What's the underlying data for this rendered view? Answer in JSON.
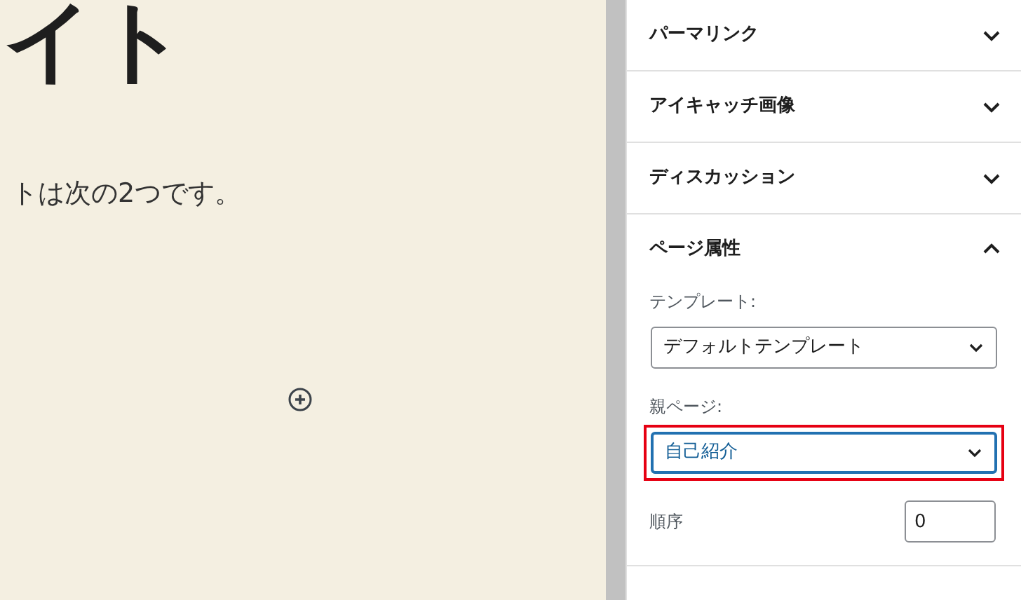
{
  "editor": {
    "heading": "イト",
    "paragraph": "トは次の2つです。"
  },
  "sidebar": {
    "panels": [
      {
        "title": "パーマリンク",
        "expanded": false
      },
      {
        "title": "アイキャッチ画像",
        "expanded": false
      },
      {
        "title": "ディスカッション",
        "expanded": false
      },
      {
        "title": "ページ属性",
        "expanded": true,
        "fields": [
          {
            "kind": "select",
            "label": "テンプレート:",
            "value": "デフォルトテンプレート",
            "focused": false,
            "highlighted": false
          },
          {
            "kind": "select",
            "label": "親ページ:",
            "value": "自己紹介",
            "focused": true,
            "highlighted": true
          },
          {
            "kind": "number",
            "label": "順序",
            "value": "0"
          }
        ]
      }
    ]
  }
}
